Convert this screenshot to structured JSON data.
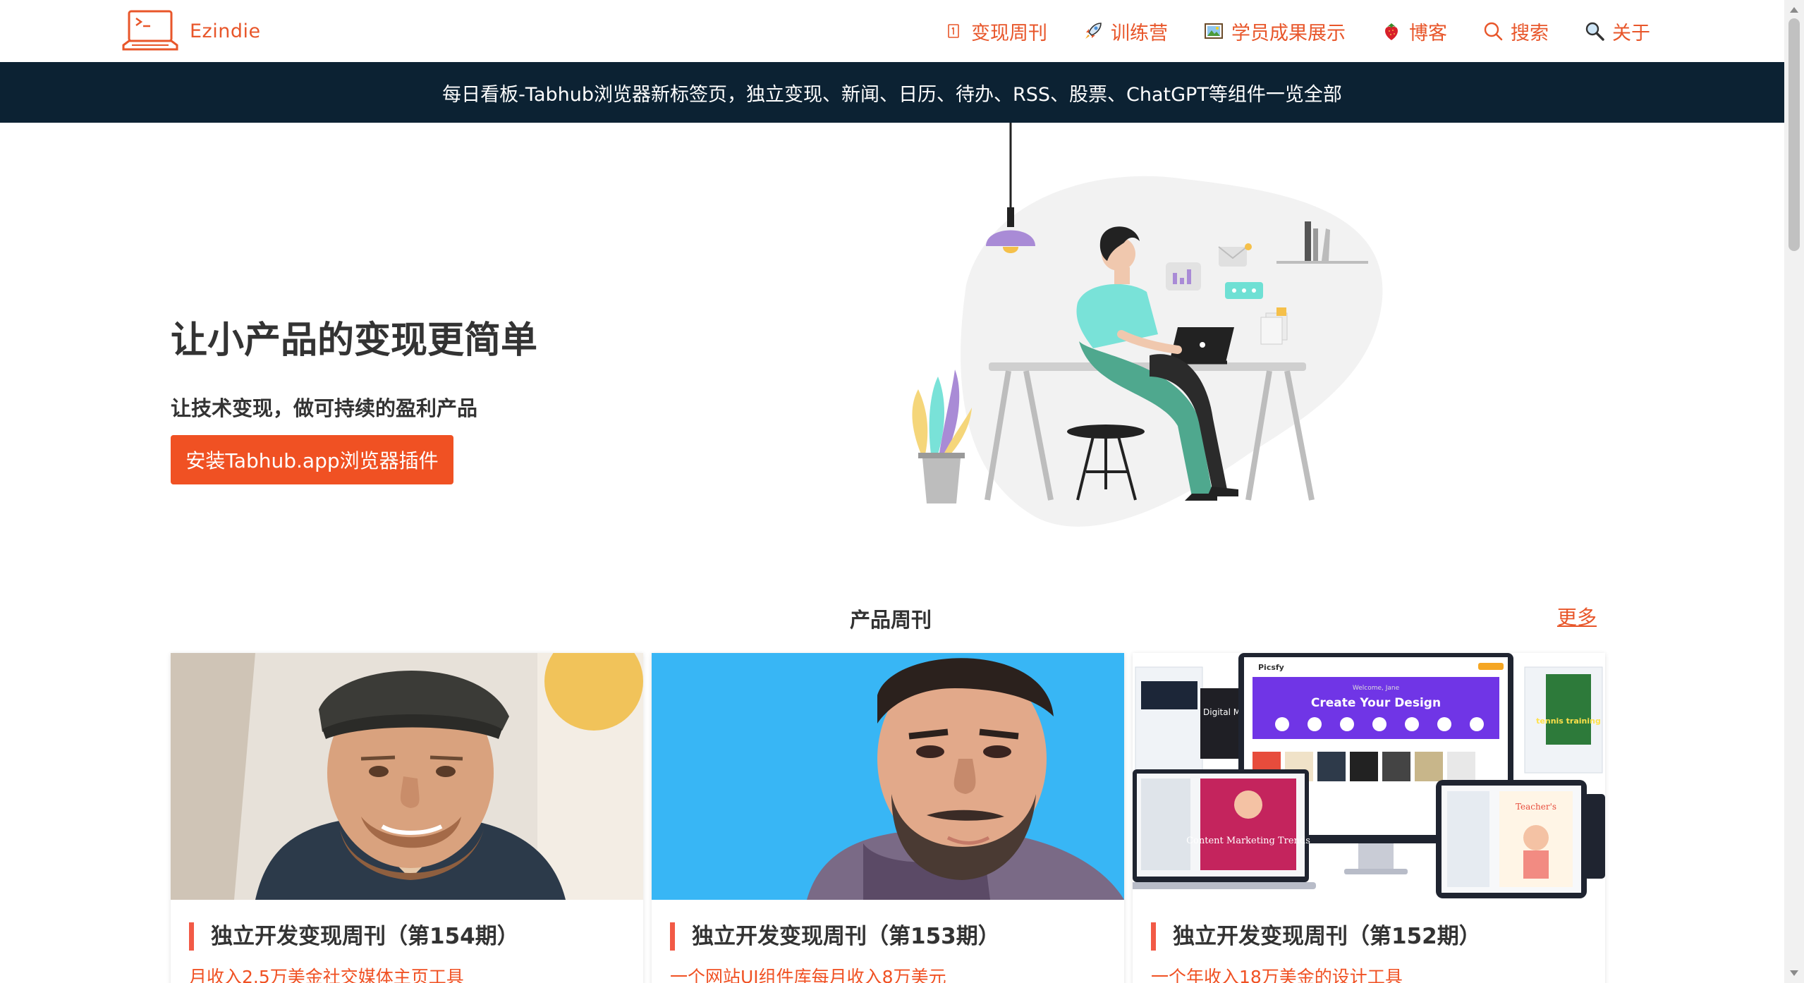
{
  "brand": {
    "name": "Ezindie",
    "logo_icon": "laptop-terminal-icon"
  },
  "nav": {
    "items": [
      {
        "label": "变现周刊",
        "icon": "calendar-icon"
      },
      {
        "label": "训练营",
        "icon": "rocket-icon"
      },
      {
        "label": "学员成果展示",
        "icon": "picture-icon"
      },
      {
        "label": "博客",
        "icon": "strawberry-icon"
      },
      {
        "label": "搜索",
        "icon": "search-icon"
      },
      {
        "label": "关于",
        "icon": "magnifier-icon"
      }
    ]
  },
  "banner": {
    "text": "每日看板-Tabhub浏览器新标签页，独立变现、新闻、日历、待办、RSS、股票、ChatGPT等组件一览全部"
  },
  "hero": {
    "title": "让小产品的变现更简单",
    "subtitle": "让技术变现，做可持续的盈利产品",
    "cta_label": "安装Tabhub.app浏览器插件"
  },
  "weekly": {
    "title": "产品周刊",
    "more_label": "更多",
    "cards": [
      {
        "title": "独立开发变现周刊（第154期）",
        "subtitle": "月收入2.5万美金社交媒体主页工具"
      },
      {
        "title": "独立开发变现周刊（第153期）",
        "subtitle": "一个网站UI组件库每月收入8万美元"
      },
      {
        "title": "独立开发变现周刊（第152期）",
        "subtitle": "一个年收入18万美金的设计工具",
        "image_text": {
          "app_name": "Picsfy",
          "headline": "Create Your Design",
          "welcome": "Welcome, Jane",
          "poster_1": "Digital Marketing Agency",
          "poster_2": "Content Marketing Trends",
          "poster_3": "Teacher's",
          "poster_4": "tennis training"
        }
      }
    ]
  },
  "colors": {
    "accent": "#f05123",
    "brand": "#e8562a",
    "banner_bg": "#0c2233",
    "card_bar": "#f25a46"
  }
}
